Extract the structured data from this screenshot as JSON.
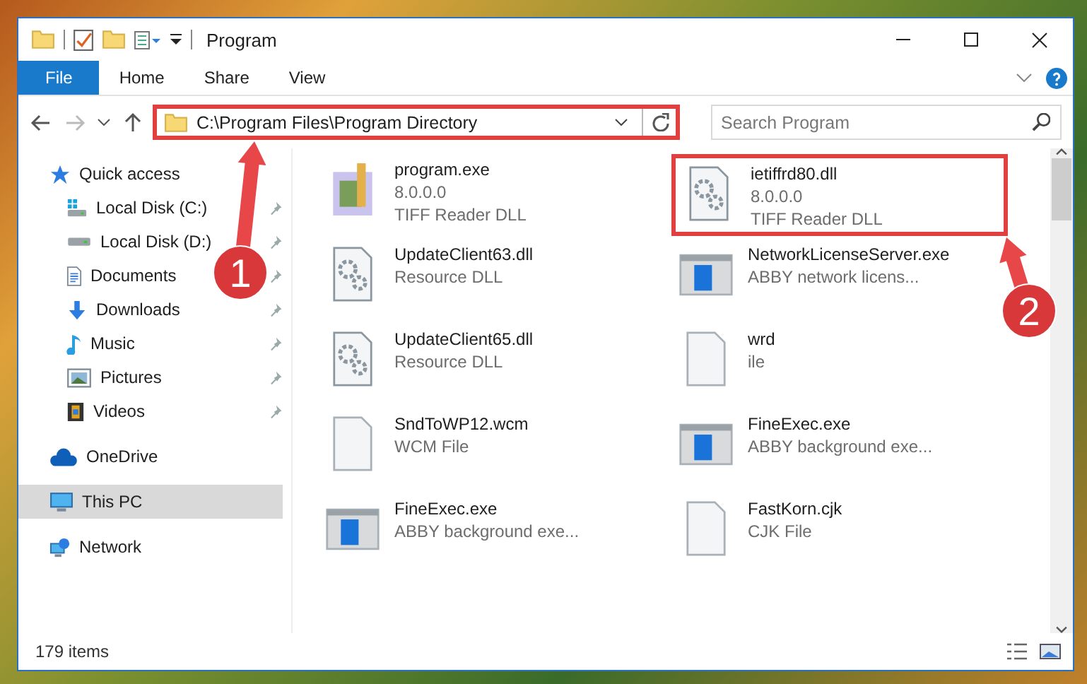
{
  "window": {
    "title": "Program"
  },
  "ribbon": {
    "tabs": [
      {
        "label": "File",
        "selected": true
      },
      {
        "label": "Home",
        "selected": false
      },
      {
        "label": "Share",
        "selected": false
      },
      {
        "label": "View",
        "selected": false
      }
    ]
  },
  "address_bar": {
    "path": "C:\\Program Files\\Program Directory",
    "highlighted": true
  },
  "search": {
    "placeholder": "Search Program"
  },
  "sidebar": {
    "items": [
      {
        "label": "Quick access",
        "selected": false,
        "children": [
          {
            "label": "Local Disk (C:)",
            "pinned": true,
            "selected": false
          },
          {
            "label": "Local Disk (D:)",
            "pinned": true,
            "selected": false
          },
          {
            "label": "Documents",
            "pinned": true,
            "selected": false
          },
          {
            "label": "Downloads",
            "pinned": true,
            "selected": false
          },
          {
            "label": "Music",
            "pinned": true,
            "selected": false
          },
          {
            "label": "Pictures",
            "pinned": true,
            "selected": false
          },
          {
            "label": "Videos",
            "pinned": true,
            "selected": false
          }
        ]
      },
      {
        "label": "OneDrive",
        "selected": false
      },
      {
        "label": "This PC",
        "selected": true
      },
      {
        "label": "Network",
        "selected": false
      }
    ]
  },
  "files": [
    {
      "name": "program.exe",
      "details": [
        "8.0.0.0",
        "TIFF Reader DLL"
      ],
      "kind": "installer",
      "highlighted": false
    },
    {
      "name": "ietiffrd80.dll",
      "details": [
        "8.0.0.0",
        "TIFF Reader DLL"
      ],
      "kind": "dll",
      "highlighted": true
    },
    {
      "name": "UpdateClient63.dll",
      "details": [
        "Resource DLL"
      ],
      "kind": "dll",
      "highlighted": false
    },
    {
      "name": "NetworkLicenseServer.exe",
      "details": [
        "ABBY network licens..."
      ],
      "kind": "app",
      "highlighted": false
    },
    {
      "name": "UpdateClient65.dll",
      "details": [
        "Resource DLL"
      ],
      "kind": "dll",
      "highlighted": false
    },
    {
      "name": "wrd",
      "details": [
        "ile"
      ],
      "kind": "blank",
      "highlighted": false
    },
    {
      "name": "SndToWP12.wcm",
      "details": [
        "WCM File"
      ],
      "kind": "blank",
      "highlighted": false
    },
    {
      "name": "FineExec.exe",
      "details": [
        "ABBY background exe..."
      ],
      "kind": "app",
      "highlighted": false
    },
    {
      "name": "FineExec.exe",
      "details": [
        "ABBY background exe..."
      ],
      "kind": "app",
      "highlighted": false
    },
    {
      "name": "FastKorn.cjk",
      "details": [
        "CJK File"
      ],
      "kind": "blank",
      "highlighted": false
    }
  ],
  "status_bar": {
    "count": "179 items"
  },
  "callouts": [
    {
      "label": "1"
    },
    {
      "label": "2"
    }
  ]
}
